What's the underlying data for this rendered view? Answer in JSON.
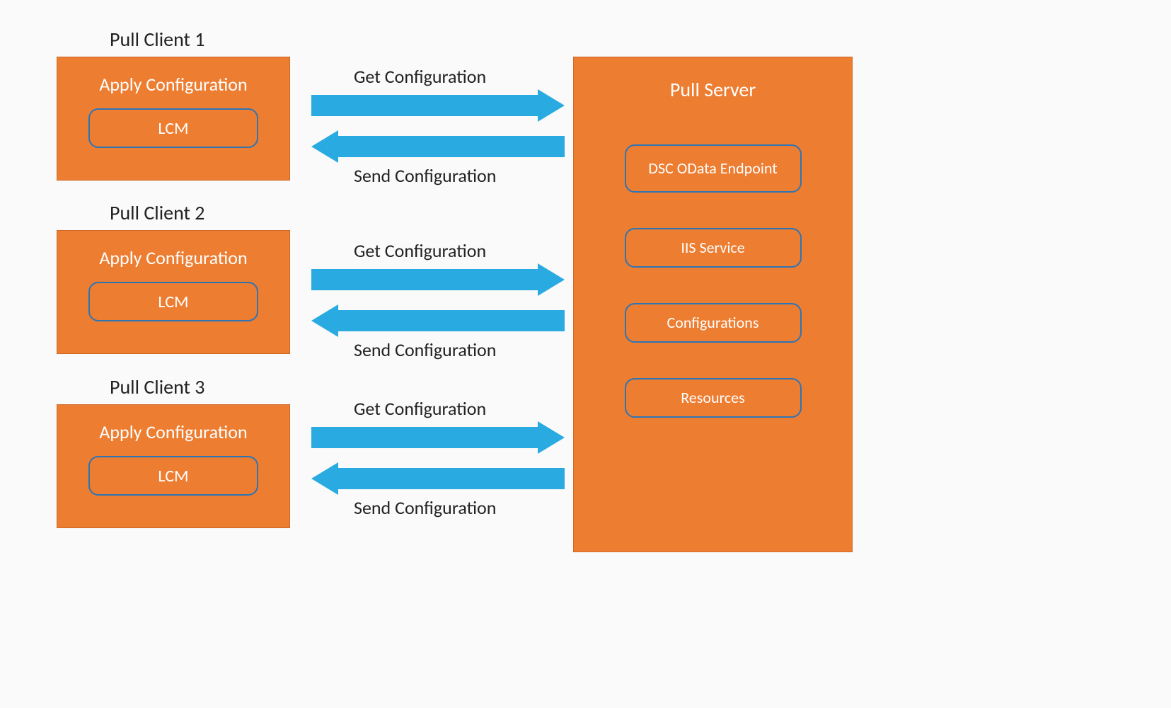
{
  "clients": [
    {
      "label": "Pull Client 1",
      "heading": "Apply Configuration",
      "inner": "LCM"
    },
    {
      "label": "Pull Client 2",
      "heading": "Apply Configuration",
      "inner": "LCM"
    },
    {
      "label": "Pull Client 3",
      "heading": "Apply Configuration",
      "inner": "LCM"
    }
  ],
  "server": {
    "heading": "Pull Server",
    "items": [
      "DSC OData Endpoint",
      "IIS Service",
      "Configurations",
      "Resources"
    ]
  },
  "arrowLabels": {
    "get": "Get Configuration",
    "send": "Send Configuration"
  },
  "colors": {
    "orange": "#ED7D31",
    "blue": "#29ABE2",
    "borderBlue": "#2E75B6"
  }
}
